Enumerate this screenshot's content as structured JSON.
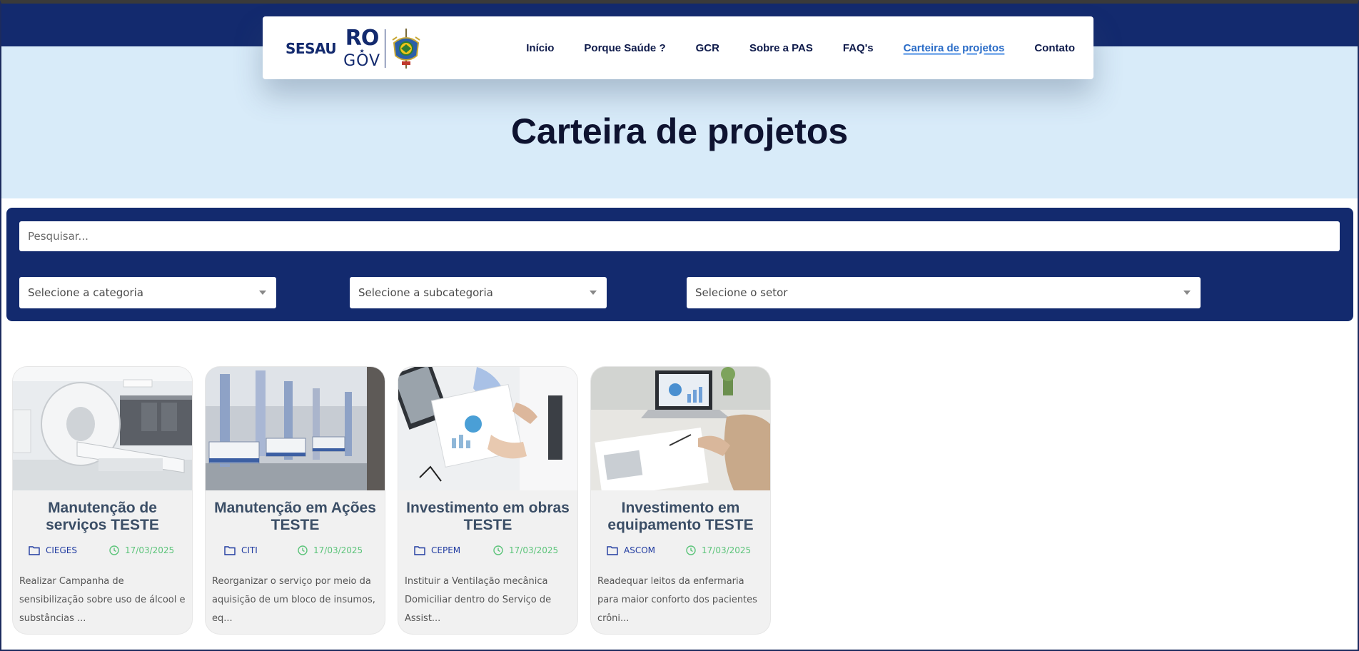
{
  "site": {
    "logo": {
      "sesau": "SESAU",
      "ro": "RO",
      "gov": "GOV"
    }
  },
  "nav": {
    "items": [
      {
        "label": "Início"
      },
      {
        "label": "Porque Saúde ?"
      },
      {
        "label": "GCR"
      },
      {
        "label": "Sobre a PAS"
      },
      {
        "label": "FAQ's"
      },
      {
        "label": "Carteira de projetos",
        "active": true
      },
      {
        "label": "Contato"
      }
    ]
  },
  "hero": {
    "title": "Carteira de projetos"
  },
  "filters": {
    "search_placeholder": "Pesquisar...",
    "category_label": "Selecione a categoria",
    "subcategory_label": "Selecione a subcategoria",
    "sector_label": "Selecione o setor"
  },
  "cards": [
    {
      "title": "Manutenção de serviços TESTE",
      "category": "CIEGES",
      "date": "17/03/2025",
      "description": "Realizar Campanha de sensibilização sobre uso de álcool e substâncias ..."
    },
    {
      "title": "Manutenção em Ações TESTE",
      "category": "CITI",
      "date": "17/03/2025",
      "description": "Reorganizar o serviço por meio da aquisição de um bloco de insumos, eq..."
    },
    {
      "title": "Investimento em obras TESTE",
      "category": "CEPEM",
      "date": "17/03/2025",
      "description": "Instituir a Ventilação mecânica Domiciliar dentro do Serviço de Assist..."
    },
    {
      "title": "Investimento em equipamento TESTE",
      "category": "ASCOM",
      "date": "17/03/2025",
      "description": "Readequar leitos da enfermaria para maior conforto dos pacientes crôni..."
    }
  ],
  "colors": {
    "brand_navy": "#132a6e",
    "hero_bg": "#d8ebf9",
    "nav_active": "#2a6cc7",
    "category_text": "#1f3aa0",
    "date_text": "#5cc47a"
  }
}
